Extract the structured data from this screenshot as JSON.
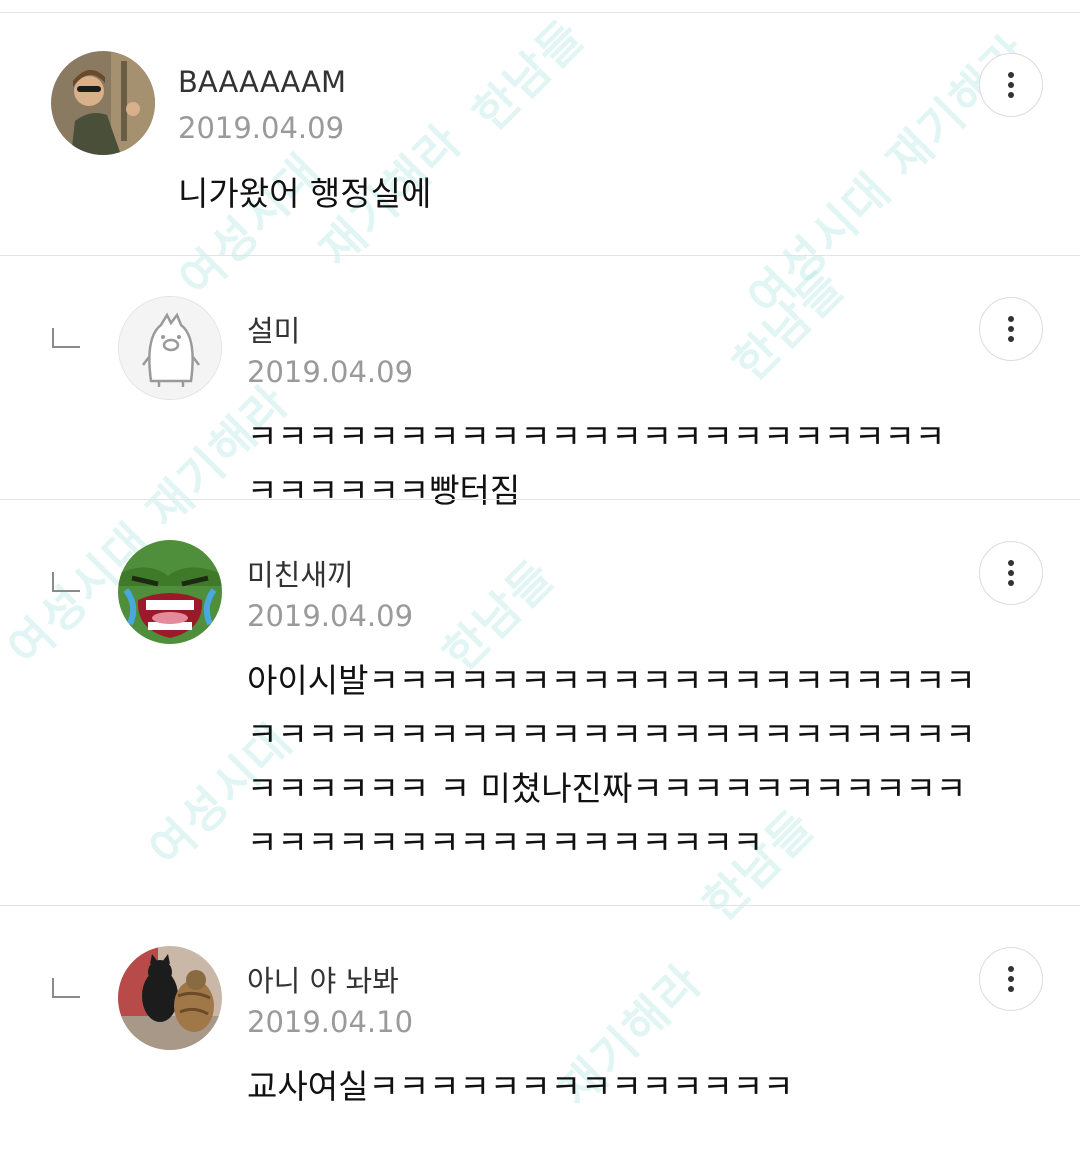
{
  "watermark": [
    "한남들",
    "여성시대 재기해라",
    "여성시대",
    "재기해라",
    "한남들",
    "여성시대 재기해라",
    "한남들",
    "여성시대",
    "재기해라",
    "한남들"
  ],
  "comments": [
    {
      "author": "BAAAAAAM",
      "date": "2019.04.09",
      "text": "니가왔어 행정실에",
      "avatar_icon": "photo-woman-pilot-avatar",
      "is_reply": false
    },
    {
      "author": "설미",
      "date": "2019.04.09",
      "text": "ㅋㅋㅋㅋㅋㅋㅋㅋㅋㅋㅋㅋㅋㅋㅋㅋㅋㅋㅋㅋㅋㅋㅋㅋㅋㅋㅋㅋㅋ빵터짐",
      "avatar_icon": "default-pig-avatar",
      "is_reply": true
    },
    {
      "author": "미친새끼",
      "date": "2019.04.09",
      "text": "아이시발ㅋㅋㅋㅋㅋㅋㅋㅋㅋㅋㅋㅋㅋㅋㅋㅋㅋㅋㅋㅋㅋㅋㅋㅋㅋㅋㅋㅋㅋㅋㅋㅋㅋㅋㅋㅋㅋㅋㅋㅋㅋㅋㅋㅋㅋㅋㅋㅋㅋㅋ ㅋ 미쳤나진짜ㅋㅋㅋㅋㅋㅋㅋㅋㅋㅋㅋㅋㅋㅋㅋㅋㅋㅋㅋㅋㅋㅋㅋㅋㅋㅋㅋㅋ",
      "avatar_icon": "angry-frog-avatar",
      "is_reply": true
    },
    {
      "author": "아니 야 놔봐",
      "date": "2019.04.10",
      "text": "교사여실ㅋㅋㅋㅋㅋㅋㅋㅋㅋㅋㅋㅋㅋㅋ",
      "avatar_icon": "photo-cats-avatar",
      "is_reply": true
    }
  ],
  "colors": {
    "divider": "#e3e3e3",
    "date": "#9a9a9a",
    "watermark": "#78d7cd"
  }
}
